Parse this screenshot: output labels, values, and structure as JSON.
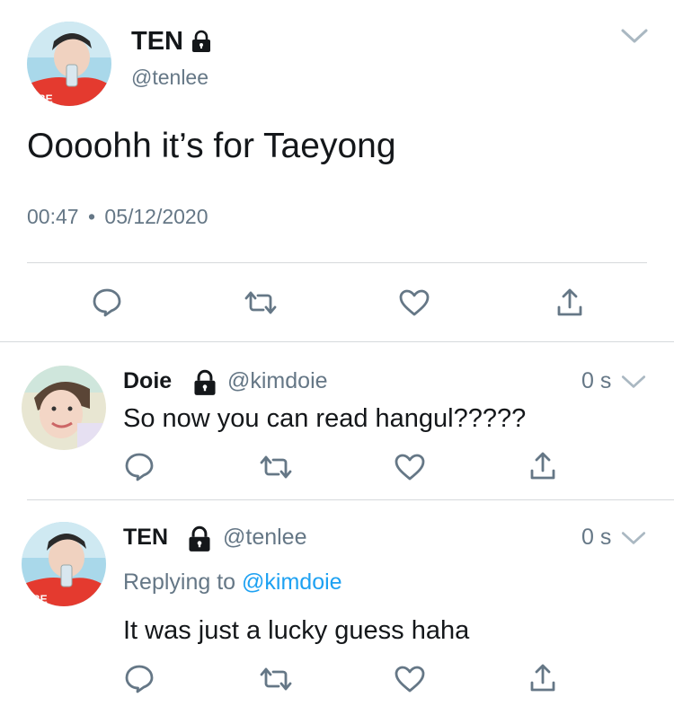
{
  "main_tweet": {
    "name": "TEN",
    "handle": "@tenlee",
    "text": "Oooohh it’s for Taeyong",
    "time": "00:47",
    "separator": "•",
    "date": "05/12/2020"
  },
  "replies": [
    {
      "name": "Doie",
      "handle": "@kimdoie",
      "age": "0 s",
      "text": "So now you can read hangul?????"
    },
    {
      "name": "TEN",
      "handle": "@tenlee",
      "age": "0 s",
      "replying_prefix": "Replying to",
      "replying_handle": "@kimdoie",
      "text": "It was just a lucky guess haha"
    }
  ],
  "colors": {
    "text": "#14171a",
    "secondary": "#657786",
    "link": "#1da1f2",
    "divider": "#d6d9dc"
  },
  "icons": [
    "lock-icon",
    "chevron-down-icon",
    "reply-icon",
    "retweet-icon",
    "like-icon",
    "share-icon"
  ]
}
